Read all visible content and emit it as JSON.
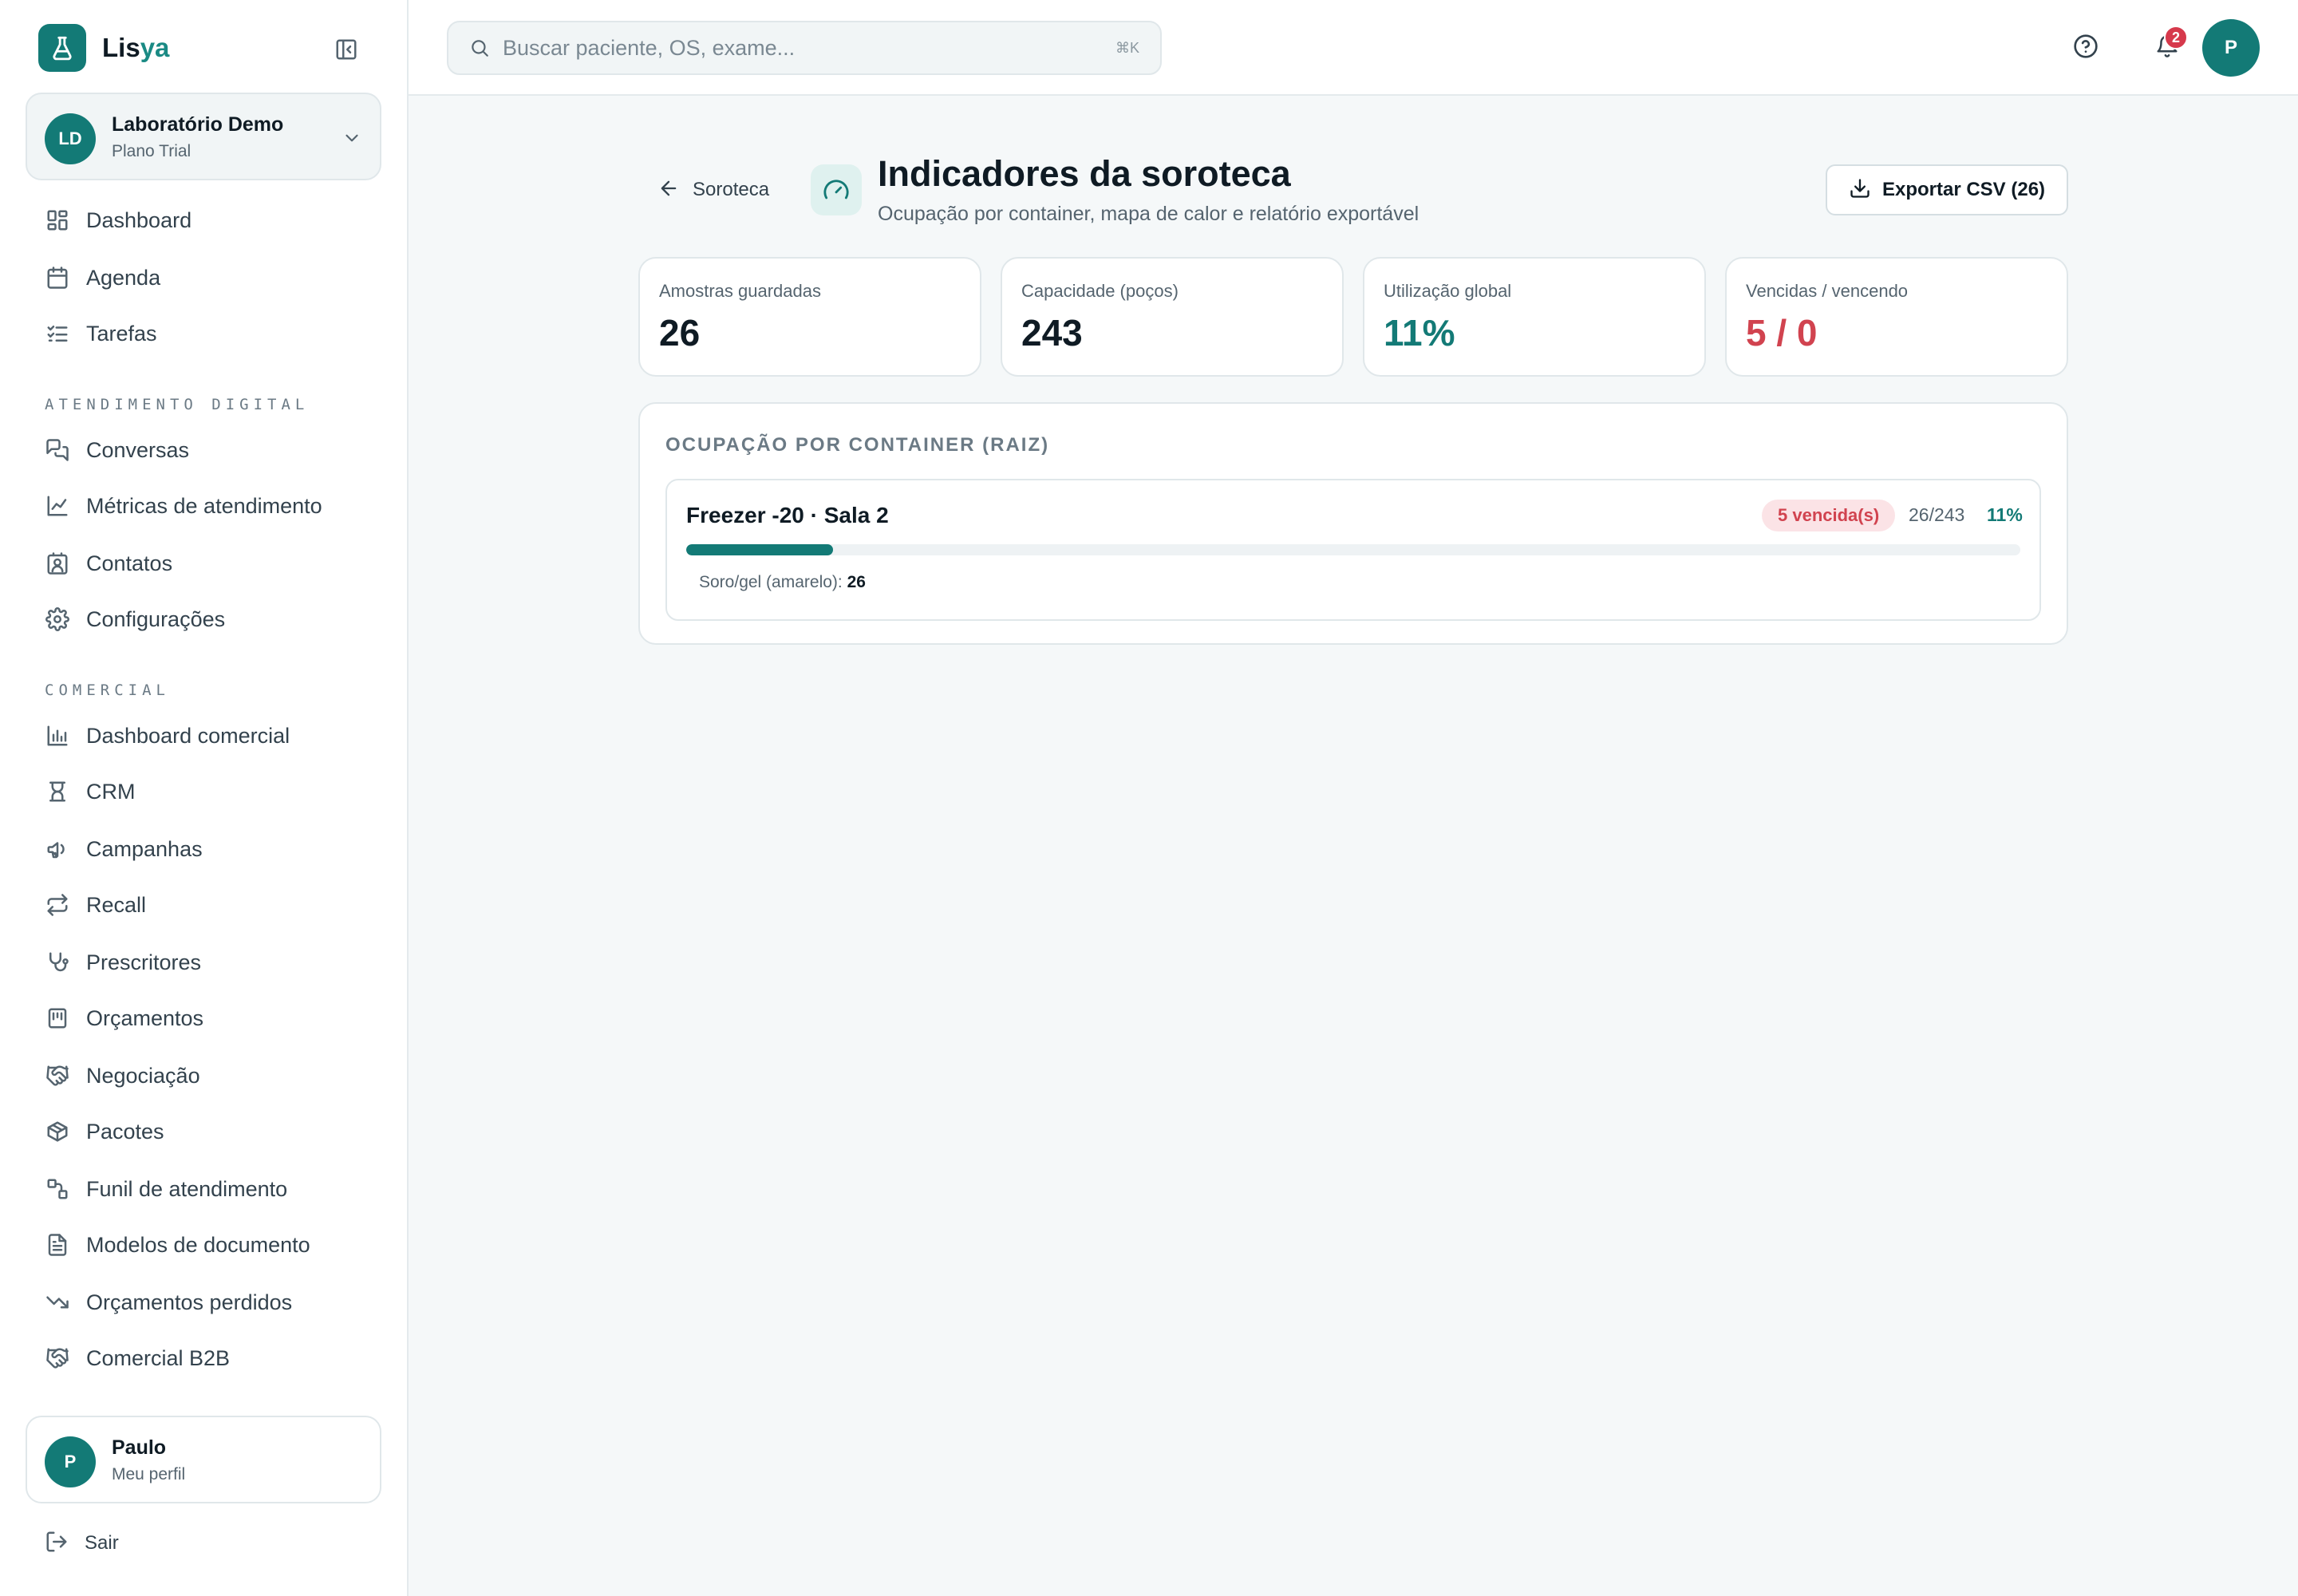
{
  "brand": {
    "name_prefix": "Lis",
    "name_accent": "ya"
  },
  "org": {
    "initials": "LD",
    "name": "Laboratório Demo",
    "plan": "Plano Trial"
  },
  "nav": {
    "main": [
      {
        "label": "Dashboard",
        "icon": "dashboard-icon"
      },
      {
        "label": "Agenda",
        "icon": "calendar-icon"
      },
      {
        "label": "Tarefas",
        "icon": "checklist-icon"
      }
    ],
    "section_digital": "ATENDIMENTO DIGITAL",
    "digital": [
      {
        "label": "Conversas",
        "icon": "chat-icon"
      },
      {
        "label": "Métricas de atendimento",
        "icon": "line-chart-icon"
      },
      {
        "label": "Contatos",
        "icon": "contact-icon"
      },
      {
        "label": "Configurações",
        "icon": "gear-icon"
      }
    ],
    "section_comercial": "COMERCIAL",
    "comercial": [
      {
        "label": "Dashboard comercial",
        "icon": "bar-chart-icon"
      },
      {
        "label": "CRM",
        "icon": "crm-icon"
      },
      {
        "label": "Campanhas",
        "icon": "megaphone-icon"
      },
      {
        "label": "Recall",
        "icon": "repeat-icon"
      },
      {
        "label": "Prescritores",
        "icon": "stethoscope-icon"
      },
      {
        "label": "Orçamentos",
        "icon": "receipt-icon"
      },
      {
        "label": "Negociação",
        "icon": "handshake-icon"
      },
      {
        "label": "Pacotes",
        "icon": "package-icon"
      },
      {
        "label": "Funil de atendimento",
        "icon": "funnel-icon"
      },
      {
        "label": "Modelos de documento",
        "icon": "document-icon"
      },
      {
        "label": "Orçamentos perdidos",
        "icon": "trending-down-icon"
      },
      {
        "label": "Comercial B2B",
        "icon": "handshake-icon"
      }
    ]
  },
  "profile": {
    "initial": "P",
    "name": "Paulo",
    "sub": "Meu perfil"
  },
  "logout_label": "Sair",
  "search": {
    "placeholder": "Buscar paciente, OS, exame...",
    "shortcut": "⌘K"
  },
  "topbar": {
    "notifications_count": "2",
    "user_initial": "P"
  },
  "page": {
    "back_label": "Soroteca",
    "title": "Indicadores da soroteca",
    "subtitle": "Ocupação por container, mapa de calor e relatório exportável",
    "export_label": "Exportar CSV (26)"
  },
  "kpis": [
    {
      "label": "Amostras guardadas",
      "value": "26",
      "tone": "default"
    },
    {
      "label": "Capacidade (poços)",
      "value": "243",
      "tone": "default"
    },
    {
      "label": "Utilização global",
      "value": "11%",
      "tone": "teal"
    },
    {
      "label": "Vencidas / vencendo",
      "value": "5 / 0",
      "tone": "red"
    }
  ],
  "occupancy": {
    "title": "OCUPAÇÃO POR CONTAINER (RAIZ)",
    "containers": [
      {
        "name": "Freezer -20 · Sala 2",
        "badge": "5 vencida(s)",
        "ratio": "26/243",
        "percent_label": "11%",
        "fill_fraction": 0.11,
        "detail_label": "Soro/gel (amarelo):",
        "detail_value": "26"
      }
    ]
  },
  "colors": {
    "primary": "#137a76",
    "danger": "#d1434f",
    "background": "#f5f8f9"
  }
}
